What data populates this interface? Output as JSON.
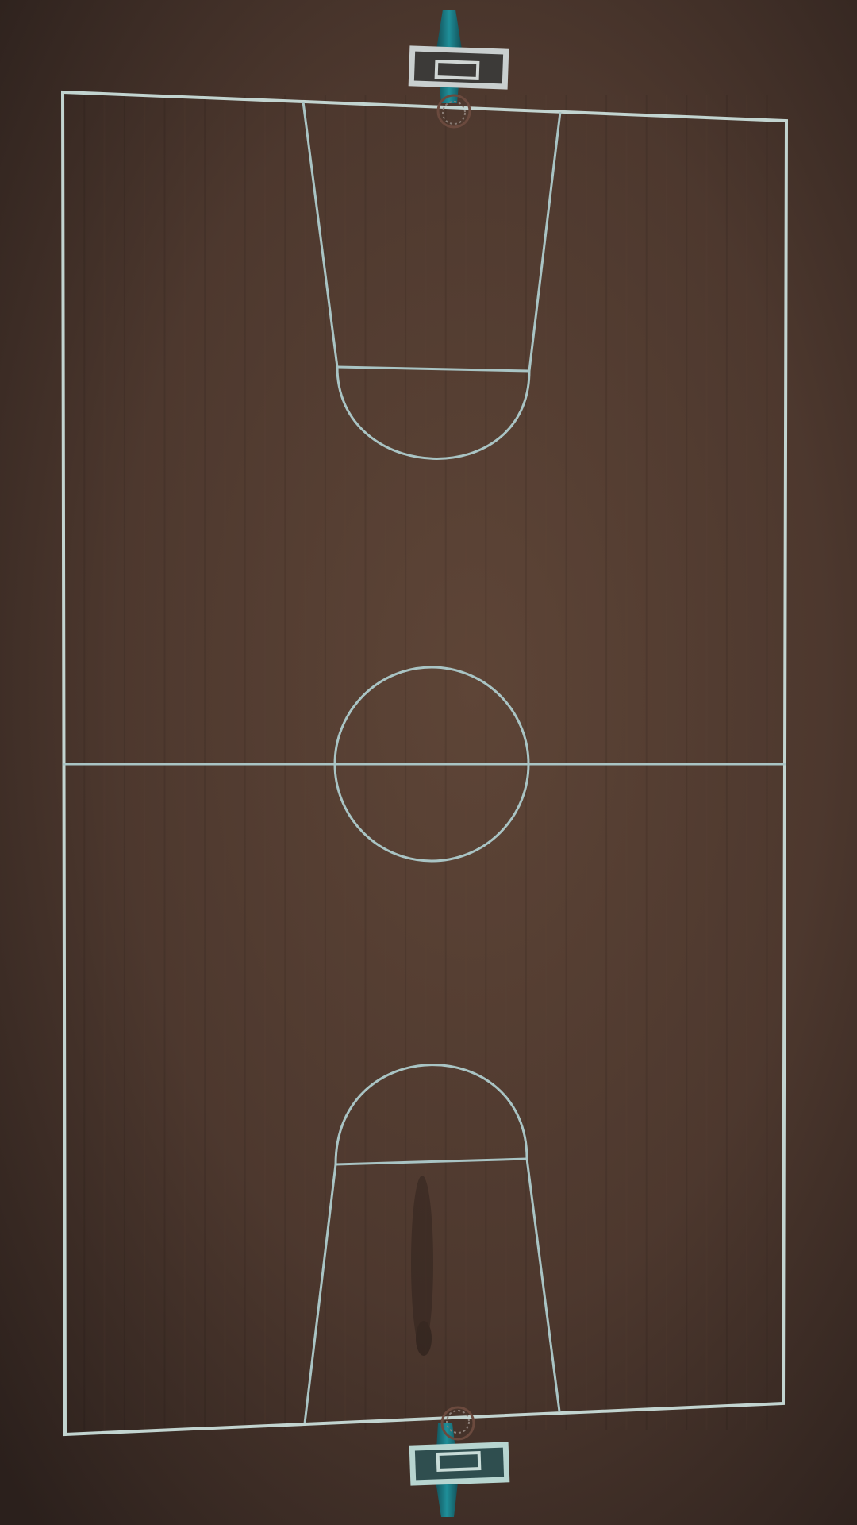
{
  "scene": {
    "subject": "basketball-court-aerial-view",
    "colors": {
      "background_dark": "#231a17",
      "floor_center": "#5e4537",
      "floor_edge": "#3a2a24",
      "court_lines": "#a9c4c4",
      "baseline_lines": "#c2d4d0",
      "backboard_frame": "#c9cfcf",
      "backboard_fill": "#3c3a38",
      "pole_teal": "#1e7d87",
      "rim_color": "#6b4a3e"
    },
    "elements": [
      "court-boundary",
      "half-court-line",
      "center-circle",
      "top-key",
      "bottom-key",
      "top-backboard",
      "bottom-backboard",
      "top-hoop",
      "bottom-hoop"
    ]
  }
}
